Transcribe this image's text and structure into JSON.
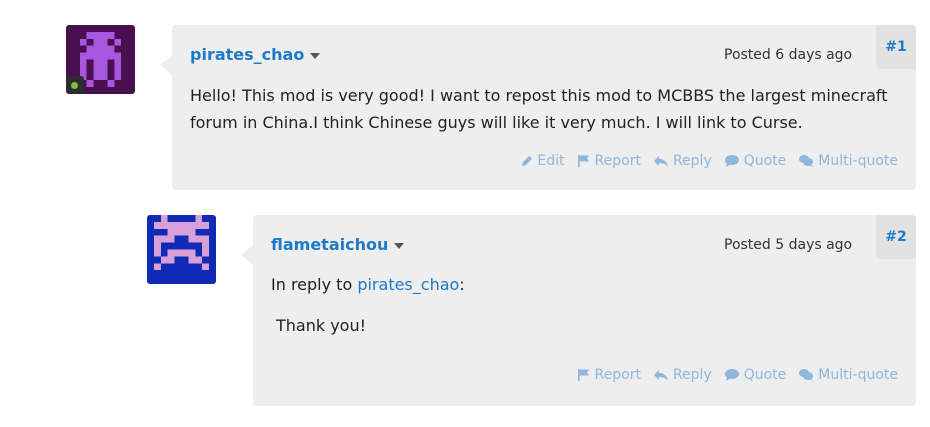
{
  "posts": [
    {
      "username": "pirates_chao",
      "posted": "Posted 6 days ago",
      "number": "#1",
      "body": "Hello! This mod is very good! I want to repost this mod to MCBBS the largest minecraft forum in China.I think Chinese guys will like it very much. I will link to Curse.",
      "actions": {
        "edit": "Edit",
        "report": "Report",
        "reply": "Reply",
        "quote": "Quote",
        "multiquote": "Multi-quote"
      },
      "avatar_colors": {
        "bg": "#4a0f4f",
        "fg": "#a855e0"
      }
    },
    {
      "username": "flametaichou",
      "posted": "Posted 5 days ago",
      "number": "#2",
      "reply_prefix": "In reply to ",
      "reply_user": "pirates_chao",
      "reply_suffix": ":",
      "body": "Thank you!",
      "actions": {
        "report": "Report",
        "reply": "Reply",
        "quote": "Quote",
        "multiquote": "Multi-quote"
      },
      "avatar_colors": {
        "bg": "#0f2ab5",
        "fg": "#d7a0d8"
      }
    }
  ],
  "colors": {
    "link": "#1f79c9",
    "action": "#8fb6dc",
    "card": "#eeeeee"
  }
}
